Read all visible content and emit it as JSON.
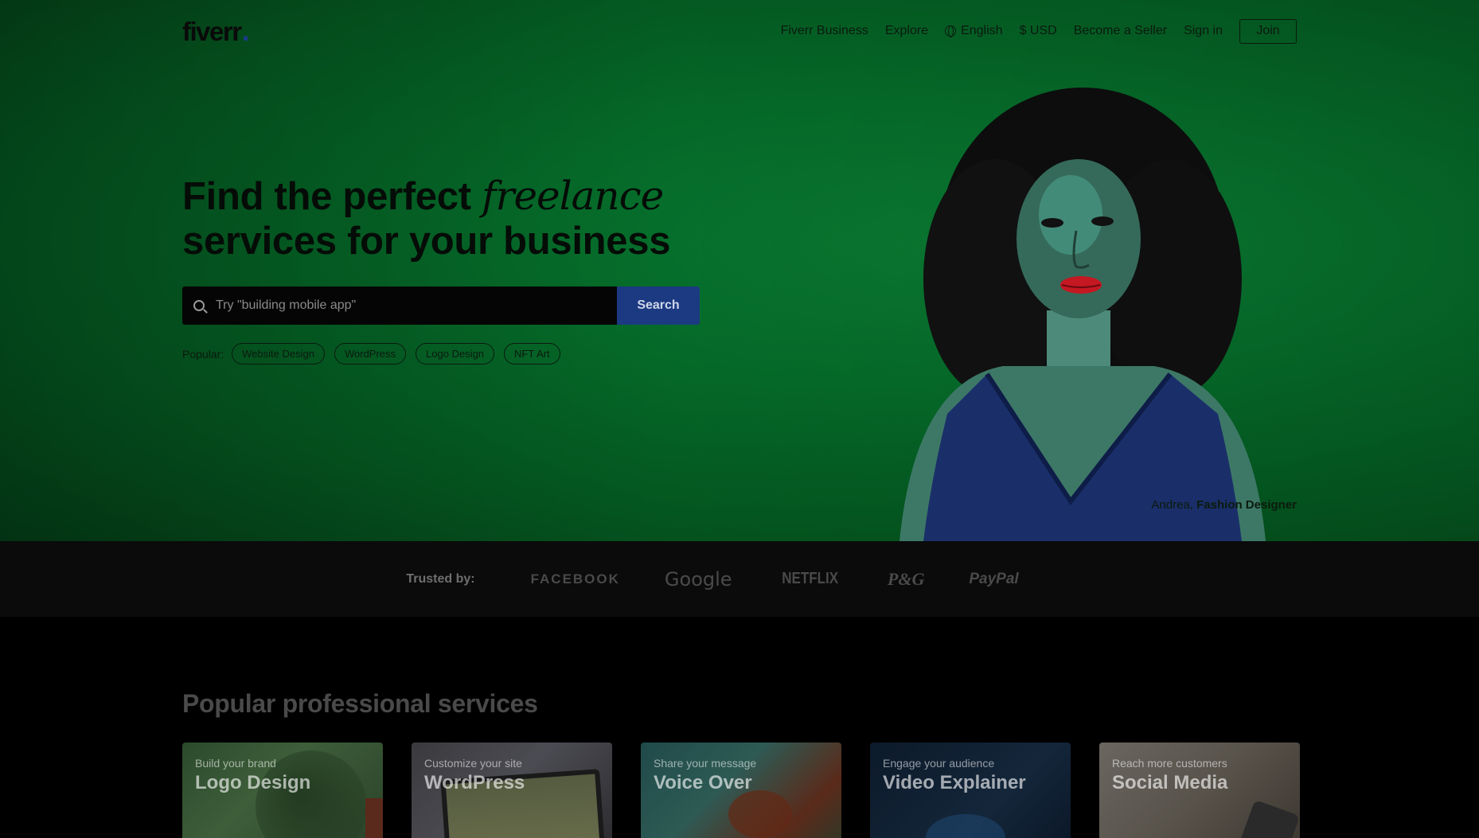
{
  "nav": {
    "logo": "fiverr",
    "logo_dot": ".",
    "links": {
      "business": "Fiverr Business",
      "explore": "Explore",
      "language": "English",
      "currency": "$ USD",
      "become_seller": "Become a Seller",
      "sign_in": "Sign in",
      "join": "Join"
    }
  },
  "hero": {
    "headline_part1": "Find the perfect ",
    "headline_italic": "freelance",
    "headline_part2": "services for your business",
    "search": {
      "placeholder": "Try \"building mobile app\"",
      "button": "Search"
    },
    "popular": {
      "label": "Popular:",
      "tags": [
        "Website Design",
        "WordPress",
        "Logo Design",
        "NFT Art"
      ]
    },
    "caption": {
      "name": "Andrea,",
      "role": "Fashion Designer"
    }
  },
  "trusted": {
    "label": "Trusted by:",
    "brands": [
      "FACEBOOK",
      "Google",
      "NETFLIX",
      "P&G",
      "PayPal"
    ]
  },
  "services": {
    "title": "Popular professional services",
    "cards": [
      {
        "subtitle": "Build your brand",
        "title": "Logo Design"
      },
      {
        "subtitle": "Customize your site",
        "title": "WordPress"
      },
      {
        "subtitle": "Share your message",
        "title": "Voice Over"
      },
      {
        "subtitle": "Engage your audience",
        "title": "Video Explainer"
      },
      {
        "subtitle": "Reach more customers",
        "title": "Social Media"
      }
    ]
  },
  "colors": {
    "hero_bg": "#056a29",
    "search_button": "#1c3a82",
    "dark_bg": "#0b0b0b"
  },
  "icons": [
    "globe-icon",
    "search-icon"
  ]
}
